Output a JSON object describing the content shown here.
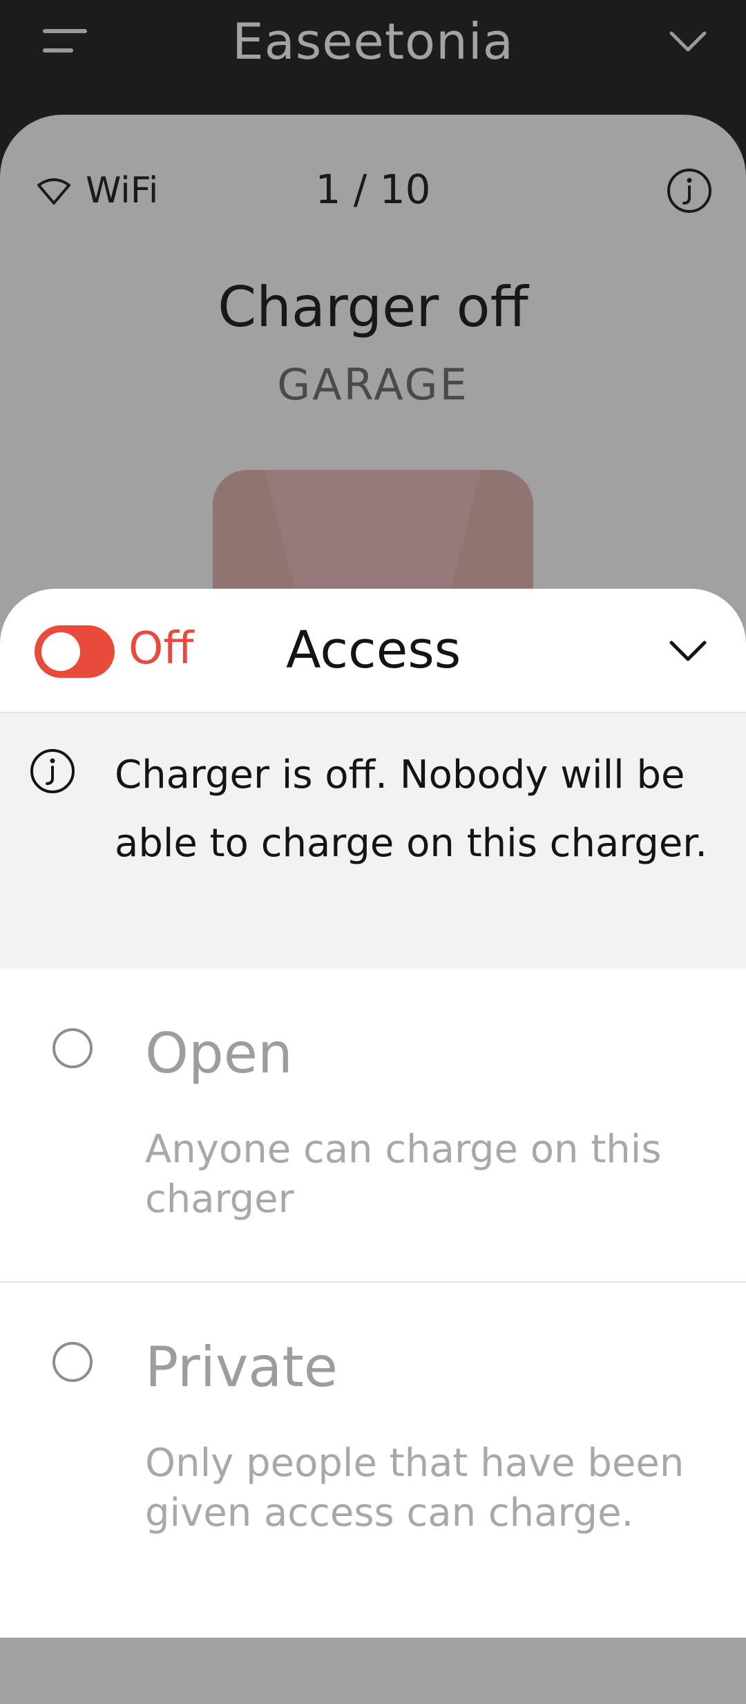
{
  "app": {
    "title": "Easeetonia"
  },
  "charger": {
    "connection": "WiFi",
    "counter": "1 / 10",
    "status": "Charger off",
    "location": "GARAGE"
  },
  "sheet": {
    "toggle_label": "Off",
    "toggle_state": "off",
    "title": "Access",
    "notice": "Charger is off. Nobody will be able to charge on this charger.",
    "options": [
      {
        "title": "Open",
        "description": "Anyone can charge on this charger",
        "selected": false
      },
      {
        "title": "Private",
        "description": "Only people that have been given access can charge.",
        "selected": false
      }
    ]
  },
  "colors": {
    "accent_red": "#e84a3c",
    "app_bar": "#1c1c1c",
    "dimmed_card": "#a1a1a1",
    "notice_bg": "#f2f2f2"
  },
  "icons": [
    "menu-icon",
    "chevron-down-icon",
    "wifi-icon",
    "info-icon"
  ]
}
